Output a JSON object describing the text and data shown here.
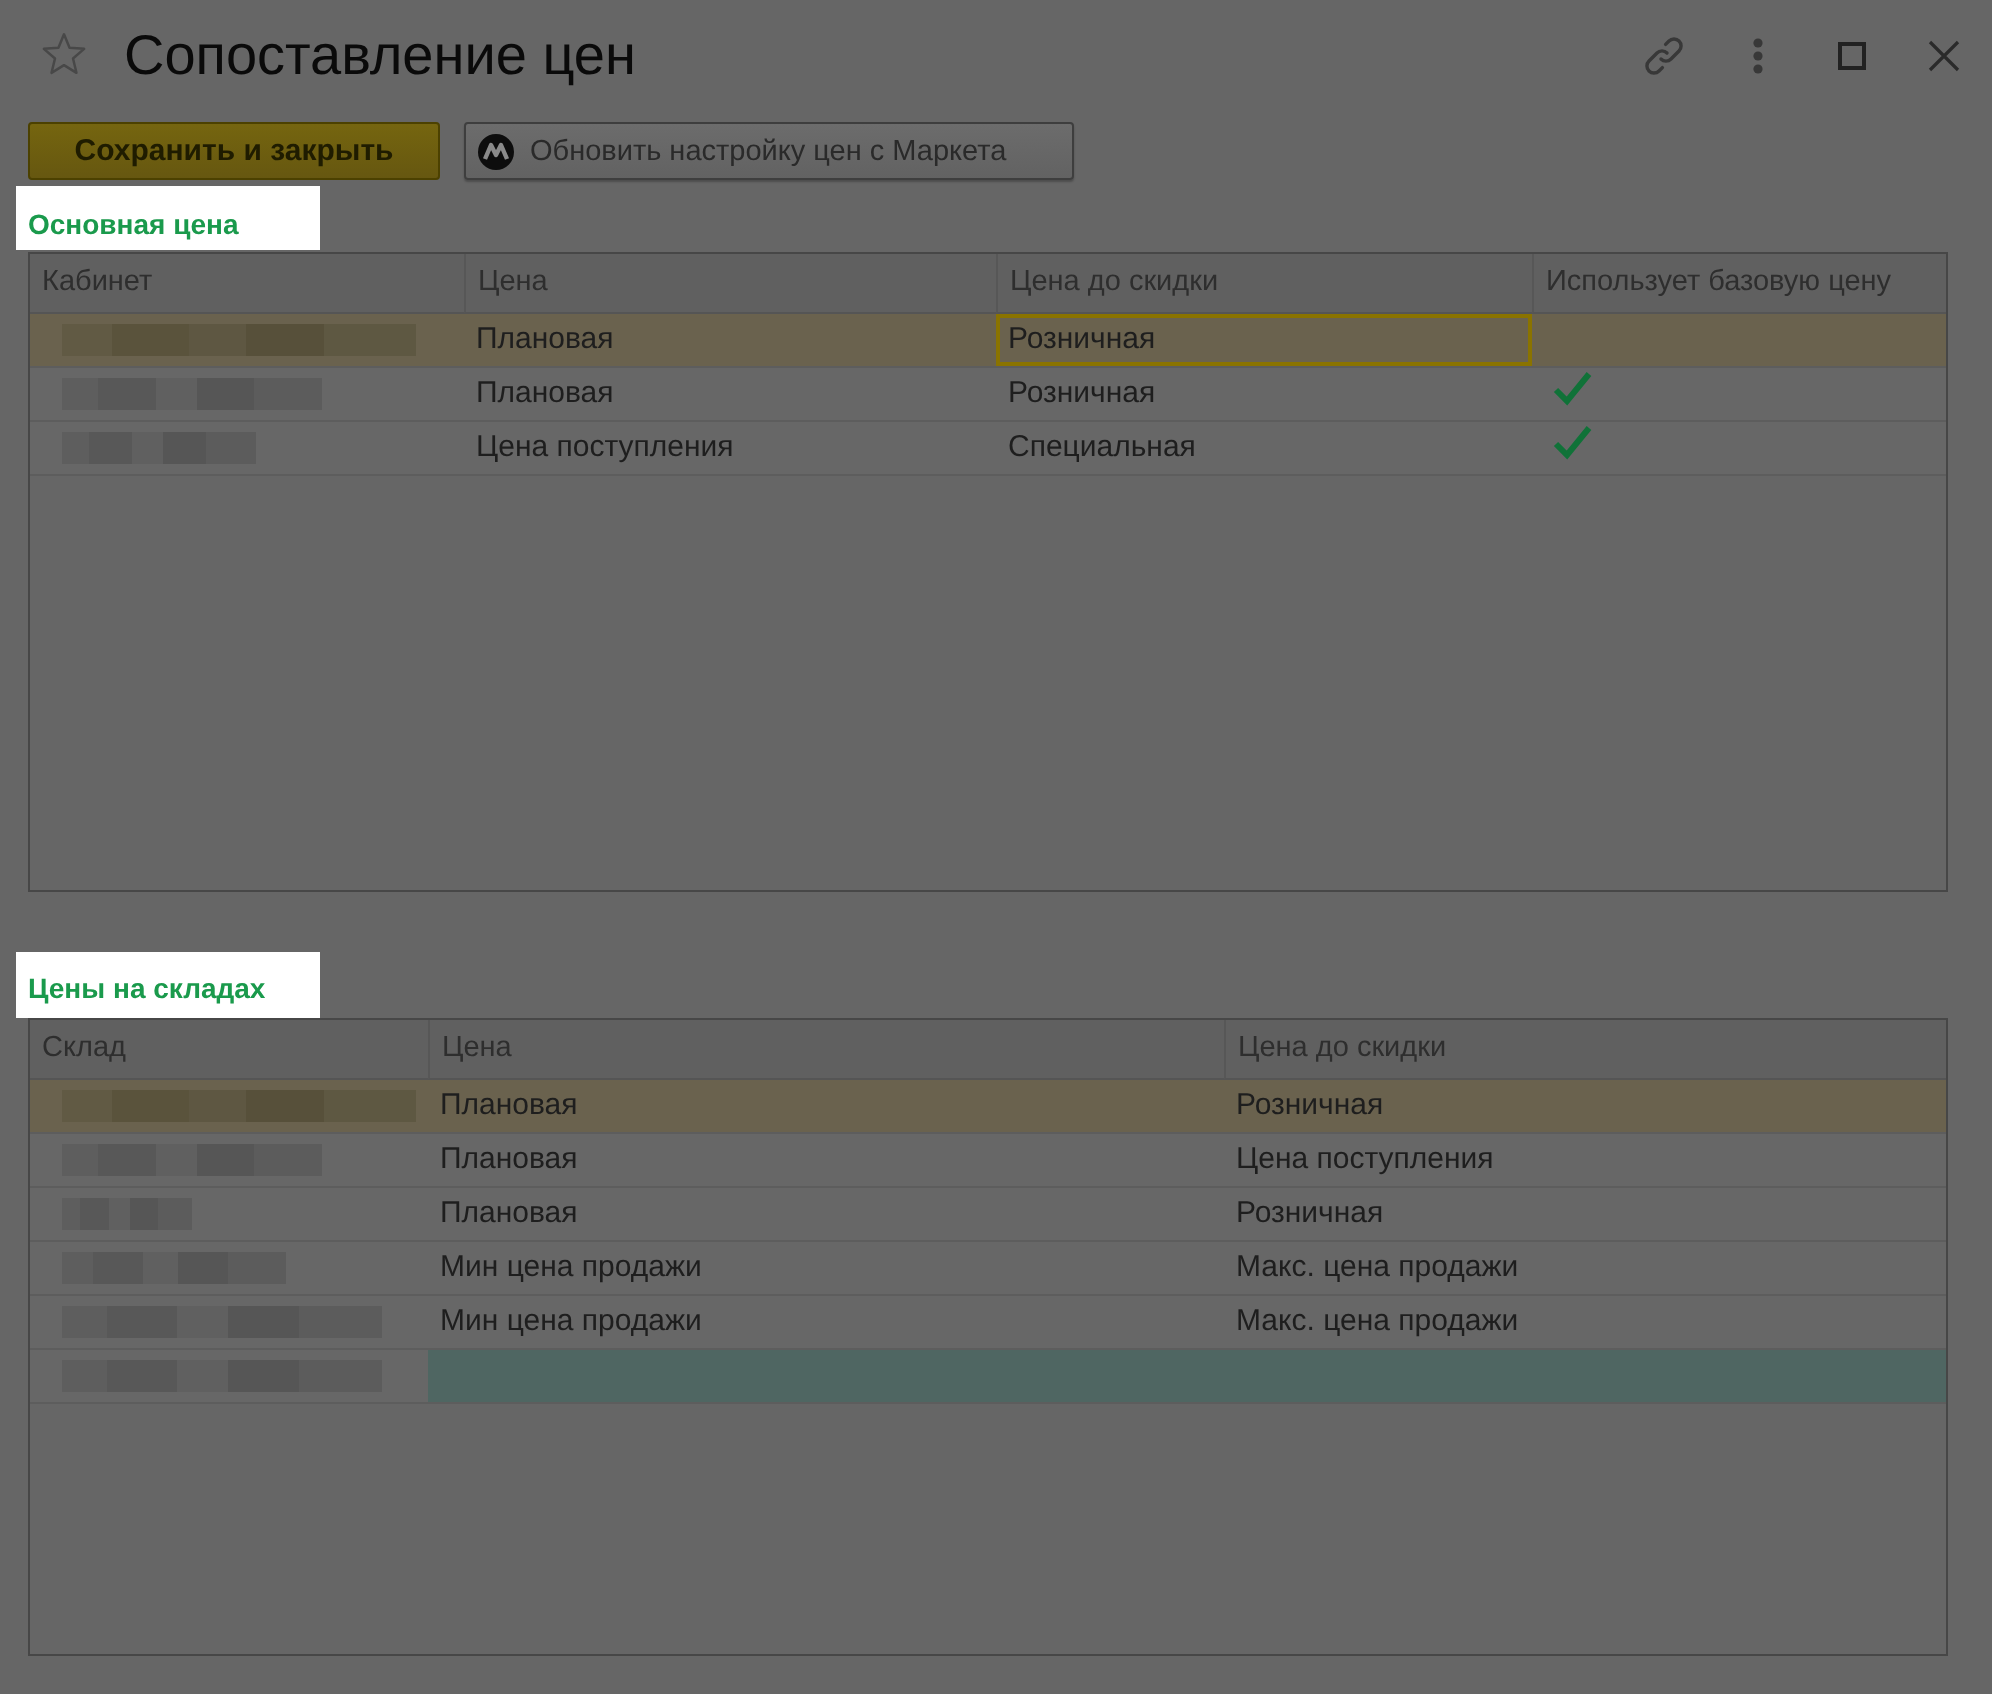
{
  "window": {
    "title": "Сопоставление цен"
  },
  "toolbar": {
    "buttons": [
      {
        "label": "Сохранить и закрыть",
        "kind": "primary"
      },
      {
        "label": "Обновить настройку цен с Маркета",
        "kind": "logo"
      }
    ]
  },
  "main_price": {
    "title": "Основная цена",
    "columns": [
      "Кабинет",
      "Цена",
      "Цена до скидки",
      "Использует базовую цену"
    ],
    "rows": [
      {
        "selected": true,
        "cells": [
          {
            "kind": "blurred"
          },
          {
            "kind": "text",
            "text": "Плановая",
            "focused": false
          },
          {
            "kind": "text",
            "text": "Розничная",
            "focused": true
          },
          {
            "kind": "check",
            "checked": false
          }
        ]
      },
      {
        "selected": false,
        "cells": [
          {
            "kind": "blurred"
          },
          {
            "kind": "text",
            "text": "Плановая",
            "focused": false
          },
          {
            "kind": "text",
            "text": "Розничная",
            "focused": false
          },
          {
            "kind": "check",
            "checked": true
          }
        ]
      },
      {
        "selected": false,
        "cells": [
          {
            "kind": "blurred"
          },
          {
            "kind": "text",
            "text": "Цена поступления",
            "focused": false
          },
          {
            "kind": "text",
            "text": "Специальная",
            "focused": false
          },
          {
            "kind": "check",
            "checked": true
          }
        ]
      }
    ]
  },
  "warehouse_prices": {
    "title": "Цены на складах",
    "columns": [
      "Склад",
      "Цена",
      "Цена до скидки"
    ],
    "rows": [
      {
        "selected": true,
        "highlighted": false,
        "cells": [
          {
            "kind": "blurred"
          },
          {
            "kind": "text",
            "text": "Плановая"
          },
          {
            "kind": "text",
            "text": "Розничная"
          }
        ]
      },
      {
        "selected": false,
        "highlighted": false,
        "cells": [
          {
            "kind": "blurred"
          },
          {
            "kind": "text",
            "text": "Плановая"
          },
          {
            "kind": "text",
            "text": "Цена поступления"
          }
        ]
      },
      {
        "selected": false,
        "highlighted": false,
        "cells": [
          {
            "kind": "blurred"
          },
          {
            "kind": "text",
            "text": "Плановая"
          },
          {
            "kind": "text",
            "text": "Розничная"
          }
        ]
      },
      {
        "selected": false,
        "highlighted": false,
        "cells": [
          {
            "kind": "blurred"
          },
          {
            "kind": "text",
            "text": "Мин цена продажи"
          },
          {
            "kind": "text",
            "text": "Макс. цена продажи"
          }
        ]
      },
      {
        "selected": false,
        "highlighted": false,
        "cells": [
          {
            "kind": "blurred"
          },
          {
            "kind": "text",
            "text": "Мин цена продажи"
          },
          {
            "kind": "text",
            "text": "Макс. цена продажи"
          }
        ]
      },
      {
        "selected": false,
        "highlighted": true,
        "cells": [
          {
            "kind": "blurred"
          }
        ]
      }
    ]
  }
}
